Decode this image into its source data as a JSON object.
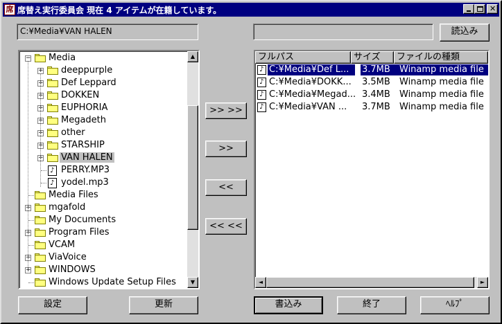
{
  "window": {
    "title": "席替え実行委員会 現在 4 アイテムが在籍しています。",
    "icon_char": "席"
  },
  "left_path": "C:¥Media¥VAN HALEN",
  "right_path": "",
  "buttons": {
    "load": "読込み",
    "move_all_right": ">> >>",
    "move_right": ">>",
    "move_left": "<<",
    "move_all_left": "<< <<",
    "settings": "設定",
    "refresh": "更新",
    "write": "書込み",
    "exit": "終了",
    "help": "ﾍﾙﾌﾟ"
  },
  "tree": [
    {
      "label": "Media",
      "depth": 0,
      "type": "folder",
      "expander": "−"
    },
    {
      "label": "deeppurple",
      "depth": 1,
      "type": "folder",
      "expander": "+"
    },
    {
      "label": "Def Leppard",
      "depth": 1,
      "type": "folder",
      "expander": "+"
    },
    {
      "label": "DOKKEN",
      "depth": 1,
      "type": "folder",
      "expander": "+"
    },
    {
      "label": "EUPHORIA",
      "depth": 1,
      "type": "folder",
      "expander": "+"
    },
    {
      "label": "Megadeth",
      "depth": 1,
      "type": "folder",
      "expander": "+"
    },
    {
      "label": "other",
      "depth": 1,
      "type": "folder",
      "expander": "+"
    },
    {
      "label": "STARSHIP",
      "depth": 1,
      "type": "folder",
      "expander": "+"
    },
    {
      "label": "VAN HALEN",
      "depth": 1,
      "type": "folder-open",
      "expander": "+",
      "selected": true
    },
    {
      "label": "PERRY.MP3",
      "depth": 1,
      "type": "file",
      "expander": ""
    },
    {
      "label": "yodel.mp3",
      "depth": 1,
      "type": "file",
      "expander": ""
    },
    {
      "label": "Media Files",
      "depth": 0,
      "type": "folder",
      "expander": ""
    },
    {
      "label": "mgafold",
      "depth": 0,
      "type": "folder",
      "expander": "+"
    },
    {
      "label": "My Documents",
      "depth": 0,
      "type": "folder",
      "expander": ""
    },
    {
      "label": "Program Files",
      "depth": 0,
      "type": "folder",
      "expander": "+"
    },
    {
      "label": "VCAM",
      "depth": 0,
      "type": "folder",
      "expander": ""
    },
    {
      "label": "ViaVoice",
      "depth": 0,
      "type": "folder",
      "expander": "+"
    },
    {
      "label": "WINDOWS",
      "depth": 0,
      "type": "folder",
      "expander": "+"
    },
    {
      "label": "Windows Update Setup Files",
      "depth": 0,
      "type": "folder",
      "expander": ""
    }
  ],
  "list": {
    "columns": [
      "フルパス",
      "サイズ",
      "ファイルの種類"
    ],
    "rows": [
      {
        "path": "C:¥Media¥Def L...",
        "size": "3.7MB",
        "kind": "Winamp media file",
        "selected": true
      },
      {
        "path": "C:¥Media¥DOKK...",
        "size": "3.5MB",
        "kind": "Winamp media file"
      },
      {
        "path": "C:¥Media¥Megad...",
        "size": "3.4MB",
        "kind": "Winamp media file"
      },
      {
        "path": "C:¥Media¥VAN ...",
        "size": "3.7MB",
        "kind": "Winamp media file"
      }
    ]
  },
  "scroll_glyphs": {
    "up": "▲",
    "down": "▼",
    "left": "◄",
    "right": "►"
  },
  "colors": {
    "titlebar": "#000080",
    "selection": "#000080",
    "face": "#c0c0c0",
    "folder": "#ffff80"
  }
}
